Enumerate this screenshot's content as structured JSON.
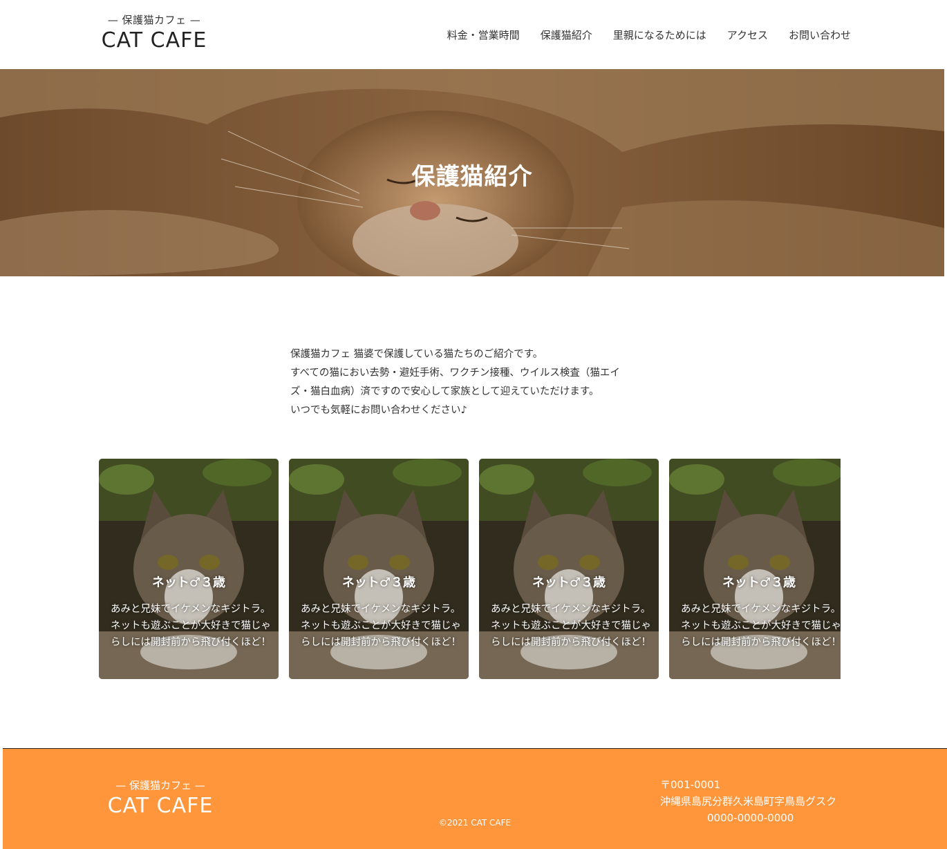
{
  "header": {
    "logo_sub": "— 保護猫カフェ —",
    "logo_main": "CAT CAFE",
    "nav": [
      "料金・営業時間",
      "保護猫紹介",
      "里親になるためには",
      "アクセス",
      "お問い合わせ"
    ]
  },
  "hero": {
    "title": "保護猫紹介"
  },
  "intro": {
    "lines": [
      "保護猫カフェ 猫婆で保護している猫たちのご紹介です。",
      "すべての猫におい去勢・避妊手術、ワクチン接種、ウイルス検査（猫エイ",
      "ズ・猫白血病）済ですので安心して家族として迎えていただけます。",
      "いつでも気軽にお問い合わせください♪"
    ]
  },
  "cards": [
    {
      "name": "ネット♂３歳",
      "desc": "あみと兄妹でイケメンなキジトラ。ネットも遊ぶことが大好きで猫じゃらしには開封前から飛び付くほど！"
    },
    {
      "name": "ネット♂３歳",
      "desc": "あみと兄妹でイケメンなキジトラ。ネットも遊ぶことが大好きで猫じゃらしには開封前から飛び付くほど！"
    },
    {
      "name": "ネット♂３歳",
      "desc": "あみと兄妹でイケメンなキジトラ。ネットも遊ぶことが大好きで猫じゃらしには開封前から飛び付くほど！"
    },
    {
      "name": "ネット♂３歳",
      "desc": "あみと兄妹でイケメンなキジトラ。ネットも遊ぶことが大好きで猫じゃらしには開封前から飛び付くほど！"
    }
  ],
  "footer": {
    "logo_sub": "— 保護猫カフェ —",
    "logo_main": "CAT CAFE",
    "copyright": "©2021 CAT CAFE",
    "postal": "〒001-0001",
    "address": "沖縄県島尻分群久米島町字鳥島グスク",
    "tel": "0000-0000-0000"
  },
  "colors": {
    "footer_bg": "#ff963b",
    "hero_tint": "#7a5533"
  }
}
